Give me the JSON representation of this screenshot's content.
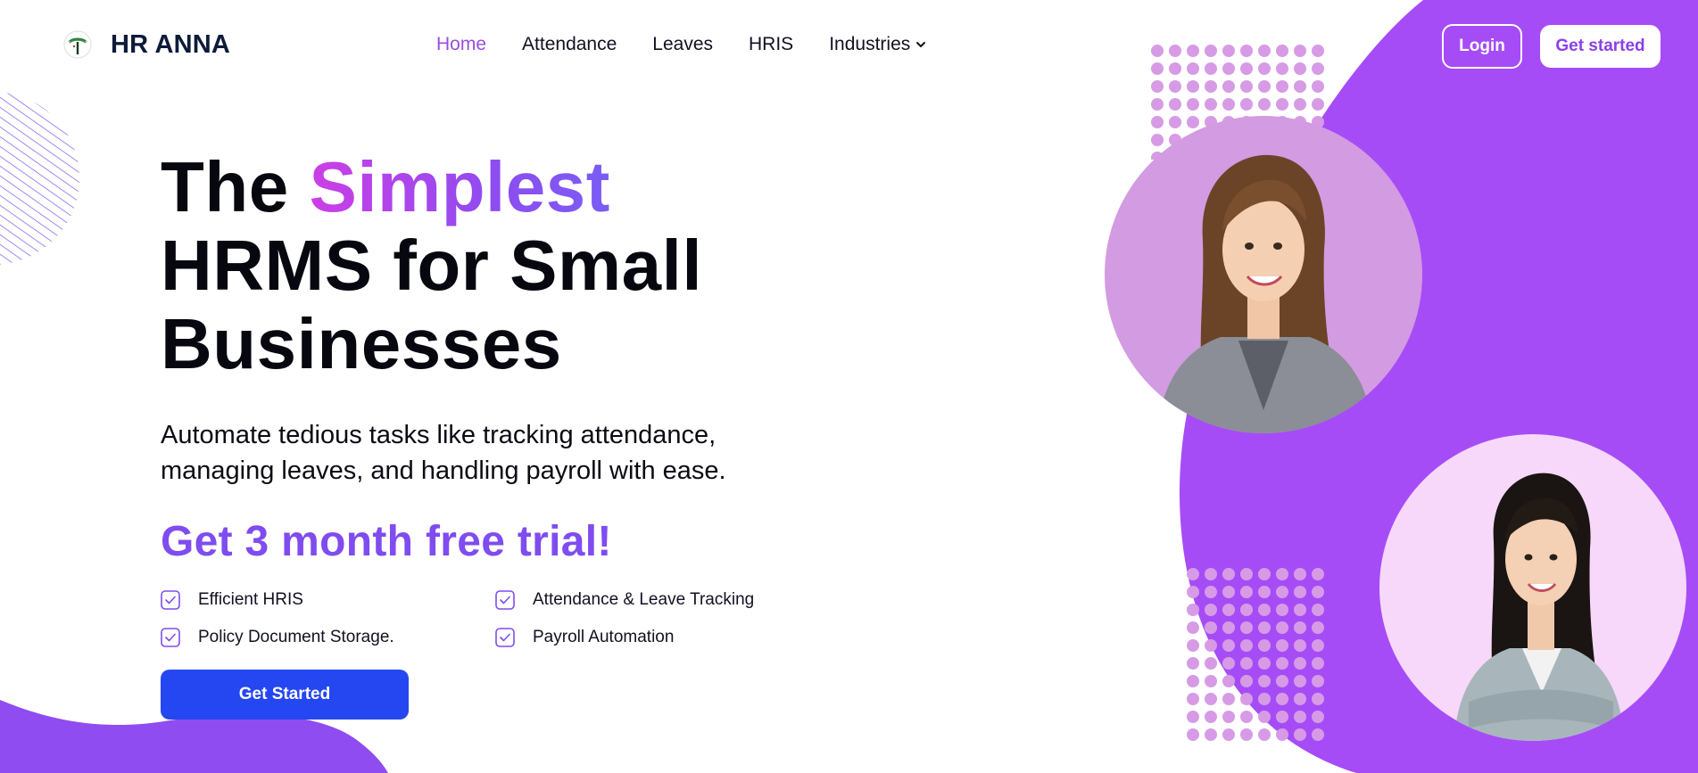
{
  "brand": {
    "name": "HR ANNA",
    "accent": "#9a4de0",
    "primary_blue": "#2447f2",
    "purple_bg": "#a64cf7"
  },
  "nav": {
    "items": [
      {
        "label": "Home",
        "active": true
      },
      {
        "label": "Attendance",
        "active": false
      },
      {
        "label": "Leaves",
        "active": false
      },
      {
        "label": "HRIS",
        "active": false
      },
      {
        "label": "Industries",
        "active": false,
        "icon": "chevron-down-icon"
      }
    ]
  },
  "header": {
    "login_label": "Login",
    "get_started_label": "Get started"
  },
  "hero": {
    "headline_the": "The",
    "headline_highlight": "Simplest",
    "headline_line2": "HRMS for Small",
    "headline_line3": "Businesses",
    "subtitle_line1": "Automate tedious tasks like tracking attendance,",
    "subtitle_line2": "managing leaves, and handling payroll with ease.",
    "trial": "Get 3 month free trial!",
    "features": [
      "Efficient HRIS",
      "Attendance & Leave Tracking",
      "Policy Document Storage.",
      "Payroll Automation"
    ],
    "cta_label": "Get Started"
  },
  "icons": {
    "logo": "tree-logo-icon",
    "feature_check": "checkbox-check-icon",
    "portraits": [
      "woman-portrait-1",
      "woman-portrait-2"
    ]
  }
}
